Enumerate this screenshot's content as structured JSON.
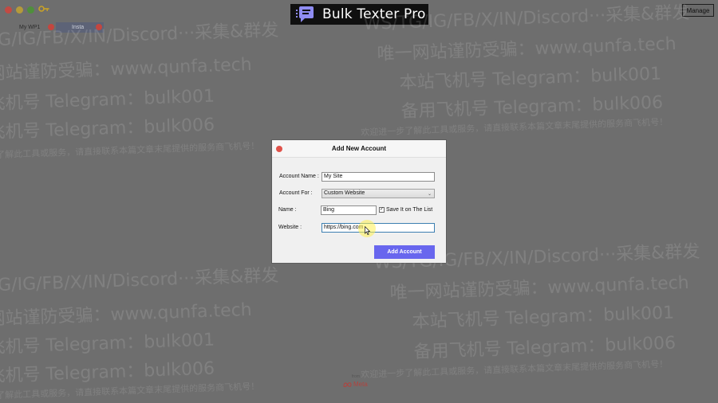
{
  "app": {
    "title": "Bulk Texter Pro",
    "manage_label": "Manage",
    "tabs": [
      {
        "label": "My WP1"
      },
      {
        "label": "Insta"
      }
    ],
    "footer": {
      "from": "from",
      "meta": "Meta"
    }
  },
  "watermark": {
    "line1": "WS/TG/IG/FB/X/IN/Discord···采集&群发",
    "line2": "唯一网站谨防受骗：www.qunfa.tech",
    "line3": "本站飞机号 Telegram：bulk001",
    "line4": "备用飞机号 Telegram：bulk006",
    "line5": "欢迎进一步了解此工具或服务，请直接联系本篇文章末尾提供的服务商飞机号！"
  },
  "modal": {
    "title": "Add New Account",
    "account_name_label": "Account Name :",
    "account_name_value": "My Site",
    "account_for_label": "Account For :",
    "account_for_value": "Custom Website",
    "name_label": "Name :",
    "name_value": "Bing",
    "save_label": "Save It on The List",
    "save_checked": "✓",
    "website_label": "Website :",
    "website_value": "https://bing.com",
    "submit_label": "Add Account"
  },
  "colors": {
    "accent": "#6866ee",
    "brand_bg": "#101010",
    "close_red": "#e0524a",
    "tab_active": "#5d6377"
  },
  "icons": [
    "key-icon",
    "chat-logo-icon",
    "close-icon",
    "chevron-down-icon",
    "checkbox-icon",
    "meta-icon",
    "cursor-icon"
  ]
}
